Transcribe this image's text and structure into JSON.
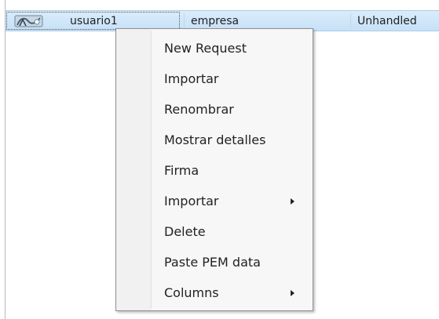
{
  "list": {
    "row": {
      "icon": "certificate-icon",
      "user": "usuario1",
      "company": "empresa",
      "status": "Unhandled"
    }
  },
  "context_menu": {
    "items": [
      {
        "label": "New Request",
        "has_submenu": false
      },
      {
        "label": "Importar",
        "has_submenu": false
      },
      {
        "label": "Renombrar",
        "has_submenu": false
      },
      {
        "label": "Mostrar detalles",
        "has_submenu": false
      },
      {
        "label": "Firma",
        "has_submenu": false
      },
      {
        "label": "Importar",
        "has_submenu": true
      },
      {
        "label": "Delete",
        "has_submenu": false
      },
      {
        "label": "Paste PEM data",
        "has_submenu": false
      },
      {
        "label": "Columns",
        "has_submenu": true
      }
    ]
  }
}
